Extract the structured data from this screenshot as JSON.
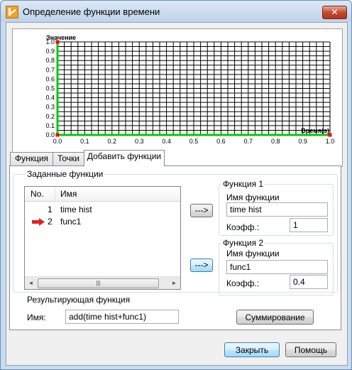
{
  "window": {
    "title": "Определение функции времени",
    "close_glyph": "✕"
  },
  "chart_data": {
    "type": "line",
    "ylabel": "Значение",
    "xlabel": "Время(s)",
    "x_ticks": [
      "0.0",
      "0.1",
      "0.2",
      "0.3",
      "0.4",
      "0.5",
      "0.6",
      "0.7",
      "0.8",
      "0.9",
      "1.0"
    ],
    "y_ticks": [
      "0.0",
      "0.1",
      "0.2",
      "0.3",
      "0.4",
      "0.5",
      "0.6",
      "0.7",
      "0.8",
      "0.9",
      "1.0"
    ],
    "xlim": [
      0,
      1
    ],
    "ylim": [
      0,
      1
    ],
    "grid": true,
    "series": [
      {
        "color": "#00cc00",
        "x": [
          0,
          0,
          1
        ],
        "y": [
          1,
          0,
          0
        ]
      }
    ],
    "markers": [
      {
        "x": 0,
        "y": 0,
        "color": "#ff0000"
      },
      {
        "x": 1,
        "y": 0,
        "color": "#ff0000"
      },
      {
        "x": 0,
        "y": 1,
        "color": "#ff0000"
      }
    ]
  },
  "tabs": [
    {
      "label": "Функция"
    },
    {
      "label": "Точки"
    },
    {
      "label": "Добавить функции"
    }
  ],
  "defined_functions": {
    "label": "Заданные функции",
    "columns": [
      "No.",
      "Имя"
    ],
    "rows": [
      {
        "no": "1",
        "name": "time hist",
        "selected": false
      },
      {
        "no": "2",
        "name": "func1",
        "selected": true
      }
    ],
    "scroll_left": "◄",
    "scroll_right": "►",
    "thumb_grip": "|||"
  },
  "arrow_button_1": "--->",
  "arrow_button_2": "--->",
  "function1": {
    "label": "Функция 1",
    "name_label": "Имя функции",
    "name_value": "time hist",
    "coef_label": "Коэфф.:",
    "coef_value": "1"
  },
  "function2": {
    "label": "Функция 2",
    "name_label": "Имя функции",
    "name_value": "func1",
    "coef_label": "Коэфф.:",
    "coef_value": "0.4"
  },
  "result": {
    "label": "Результирующая функция",
    "name_label": "Имя:",
    "name_value": "add(time hist+func1)",
    "sum_button": "Суммирование"
  },
  "footer": {
    "close_button": "Закрыть",
    "help_button": "Помощь"
  },
  "colors": {
    "series": "#00cc00",
    "marker": "#ff0000",
    "arrow": "#e02020"
  }
}
